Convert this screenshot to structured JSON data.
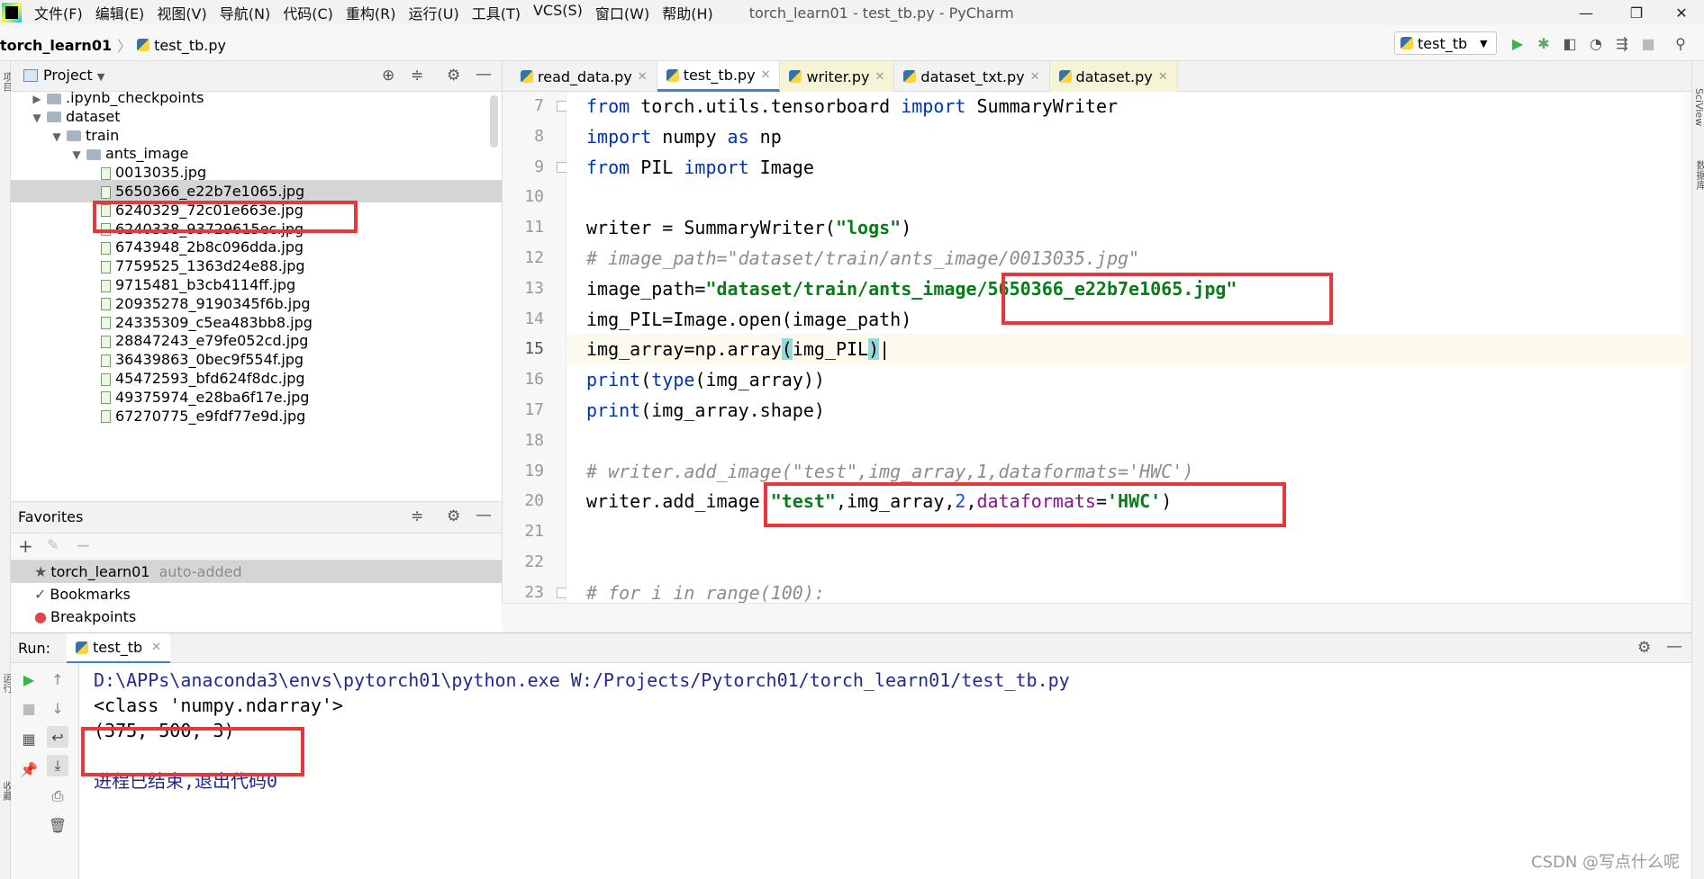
{
  "menubar": {
    "items": [
      "文件(F)",
      "编辑(E)",
      "视图(V)",
      "导航(N)",
      "代码(C)",
      "重构(R)",
      "运行(U)",
      "工具(T)",
      "VCS(S)",
      "窗口(W)",
      "帮助(H)"
    ],
    "window_title": "torch_learn01 - test_tb.py - PyCharm",
    "minimize": "—",
    "maximize": "❐",
    "close": "✕"
  },
  "navbar": {
    "project": "torch_learn01",
    "file": "test_tb.py",
    "run_config": "test_tb"
  },
  "left_stripe": {
    "label_top": "项目",
    "label_run": "运行",
    "label_fav": "收藏"
  },
  "right_stripe": {
    "label_top": "SciView",
    "label_db": "数据库"
  },
  "project_panel": {
    "title": "Project",
    "tree": [
      {
        "label": ".ipynb_checkpoints",
        "type": "folder",
        "depth": 1,
        "expanded": false
      },
      {
        "label": "dataset",
        "type": "folder",
        "depth": 1,
        "expanded": true
      },
      {
        "label": "train",
        "type": "folder",
        "depth": 2,
        "expanded": true
      },
      {
        "label": "ants_image",
        "type": "folder",
        "depth": 3,
        "expanded": true
      },
      {
        "label": "0013035.jpg",
        "type": "file",
        "depth": 4
      },
      {
        "label": "5650366_e22b7e1065.jpg",
        "type": "file",
        "depth": 4,
        "selected": true
      },
      {
        "label": "6240329_72c01e663e.jpg",
        "type": "file",
        "depth": 4
      },
      {
        "label": "6240338_93729615ec.jpg",
        "type": "file",
        "depth": 4
      },
      {
        "label": "6743948_2b8c096dda.jpg",
        "type": "file",
        "depth": 4
      },
      {
        "label": "7759525_1363d24e88.jpg",
        "type": "file",
        "depth": 4
      },
      {
        "label": "9715481_b3cb4114ff.jpg",
        "type": "file",
        "depth": 4
      },
      {
        "label": "20935278_9190345f6b.jpg",
        "type": "file",
        "depth": 4
      },
      {
        "label": "24335309_c5ea483bb8.jpg",
        "type": "file",
        "depth": 4
      },
      {
        "label": "28847243_e79fe052cd.jpg",
        "type": "file",
        "depth": 4
      },
      {
        "label": "36439863_0bec9f554f.jpg",
        "type": "file",
        "depth": 4
      },
      {
        "label": "45472593_bfd624f8dc.jpg",
        "type": "file",
        "depth": 4
      },
      {
        "label": "49375974_e28ba6f17e.jpg",
        "type": "file",
        "depth": 4
      },
      {
        "label": "67270775_e9fdf77e9d.jpg",
        "type": "file",
        "depth": 4
      }
    ]
  },
  "favorites": {
    "title": "Favorites",
    "items": [
      {
        "label": "torch_learn01",
        "note": "auto-added",
        "icon": "star-icon"
      },
      {
        "label": "Bookmarks",
        "icon": "check-icon"
      },
      {
        "label": "Breakpoints",
        "icon": "breakpoint-icon"
      }
    ]
  },
  "editor": {
    "tabs": [
      {
        "label": "read_data.py",
        "active": false,
        "yellow": false
      },
      {
        "label": "test_tb.py",
        "active": true,
        "yellow": false
      },
      {
        "label": "writer.py",
        "active": false,
        "yellow": true
      },
      {
        "label": "dataset_txt.py",
        "active": false,
        "yellow": false
      },
      {
        "label": "dataset.py",
        "active": false,
        "yellow": true
      }
    ],
    "current_line": "15",
    "lines": [
      {
        "no": "7",
        "html": "<span class=\"kw\">from</span> torch.utils.tensorboard <span class=\"kw\">import</span> SummaryWriter"
      },
      {
        "no": "8",
        "html": "<span class=\"kw\">import</span> numpy <span class=\"kw\">as</span> np"
      },
      {
        "no": "9",
        "html": "<span class=\"kw\">from</span> PIL <span class=\"kw\">import</span> Image"
      },
      {
        "no": "10",
        "html": ""
      },
      {
        "no": "11",
        "html": "writer = SummaryWriter(<span class=\"str\">\"logs\"</span>)"
      },
      {
        "no": "12",
        "html": "<span class=\"com\"># image_path=\"dataset/train/ants_image/0013035.jpg\"</span>"
      },
      {
        "no": "13",
        "html": "image_path=<span class=\"str\">\"dataset/train/ants_image/5650366_e22b7e1065.jpg\"</span>"
      },
      {
        "no": "14",
        "html": "img_PIL=Image.open(image_path)"
      },
      {
        "no": "15",
        "html": "img_array=np.array<span class=\"paren-hl\">(</span>img_PIL<span class=\"paren-hl\">)</span>|"
      },
      {
        "no": "16",
        "html": "<span class=\"bi\">print</span>(<span class=\"bi\">type</span>(img_array))"
      },
      {
        "no": "17",
        "html": "<span class=\"bi\">print</span>(img_array.shape)"
      },
      {
        "no": "18",
        "html": ""
      },
      {
        "no": "19",
        "html": "<span class=\"com\"># writer.add_image(\"test\",img_array,1,dataformats='HWC')</span>"
      },
      {
        "no": "20",
        "html": "writer.add_image(<span class=\"str\">\"test\"</span>,img_array,<span class=\"num\">2</span>,<span class=\"param\">dataformats</span>=<span class=\"str\">'HWC'</span>)"
      },
      {
        "no": "21",
        "html": ""
      },
      {
        "no": "22",
        "html": ""
      },
      {
        "no": "23",
        "html": "<span class=\"com\"># for i in range(100):</span>"
      }
    ]
  },
  "run_panel": {
    "label": "Run:",
    "tab": "test_tb",
    "output": [
      {
        "text": "D:\\APPs\\anaconda3\\envs\\pytorch01\\python.exe W:/Projects/Pytorch01/torch_learn01/test_tb.py",
        "color": "#1f2b8f"
      },
      {
        "text": "<class 'numpy.ndarray'>",
        "color": "#000000"
      },
      {
        "text": "(375, 500, 3)",
        "color": "#000000"
      },
      {
        "text": "",
        "color": "#000000"
      },
      {
        "text": "进程已结束,退出代码0",
        "color": "#1f2b8f"
      }
    ]
  },
  "watermark": "CSDN @写点什么呢",
  "colors": {
    "annotation_red": "#e8373a",
    "keyword_blue": "#0033b3",
    "string_green": "#067d17",
    "comment_gray": "#8c8c8c",
    "accent_tab": "#4083c9"
  }
}
